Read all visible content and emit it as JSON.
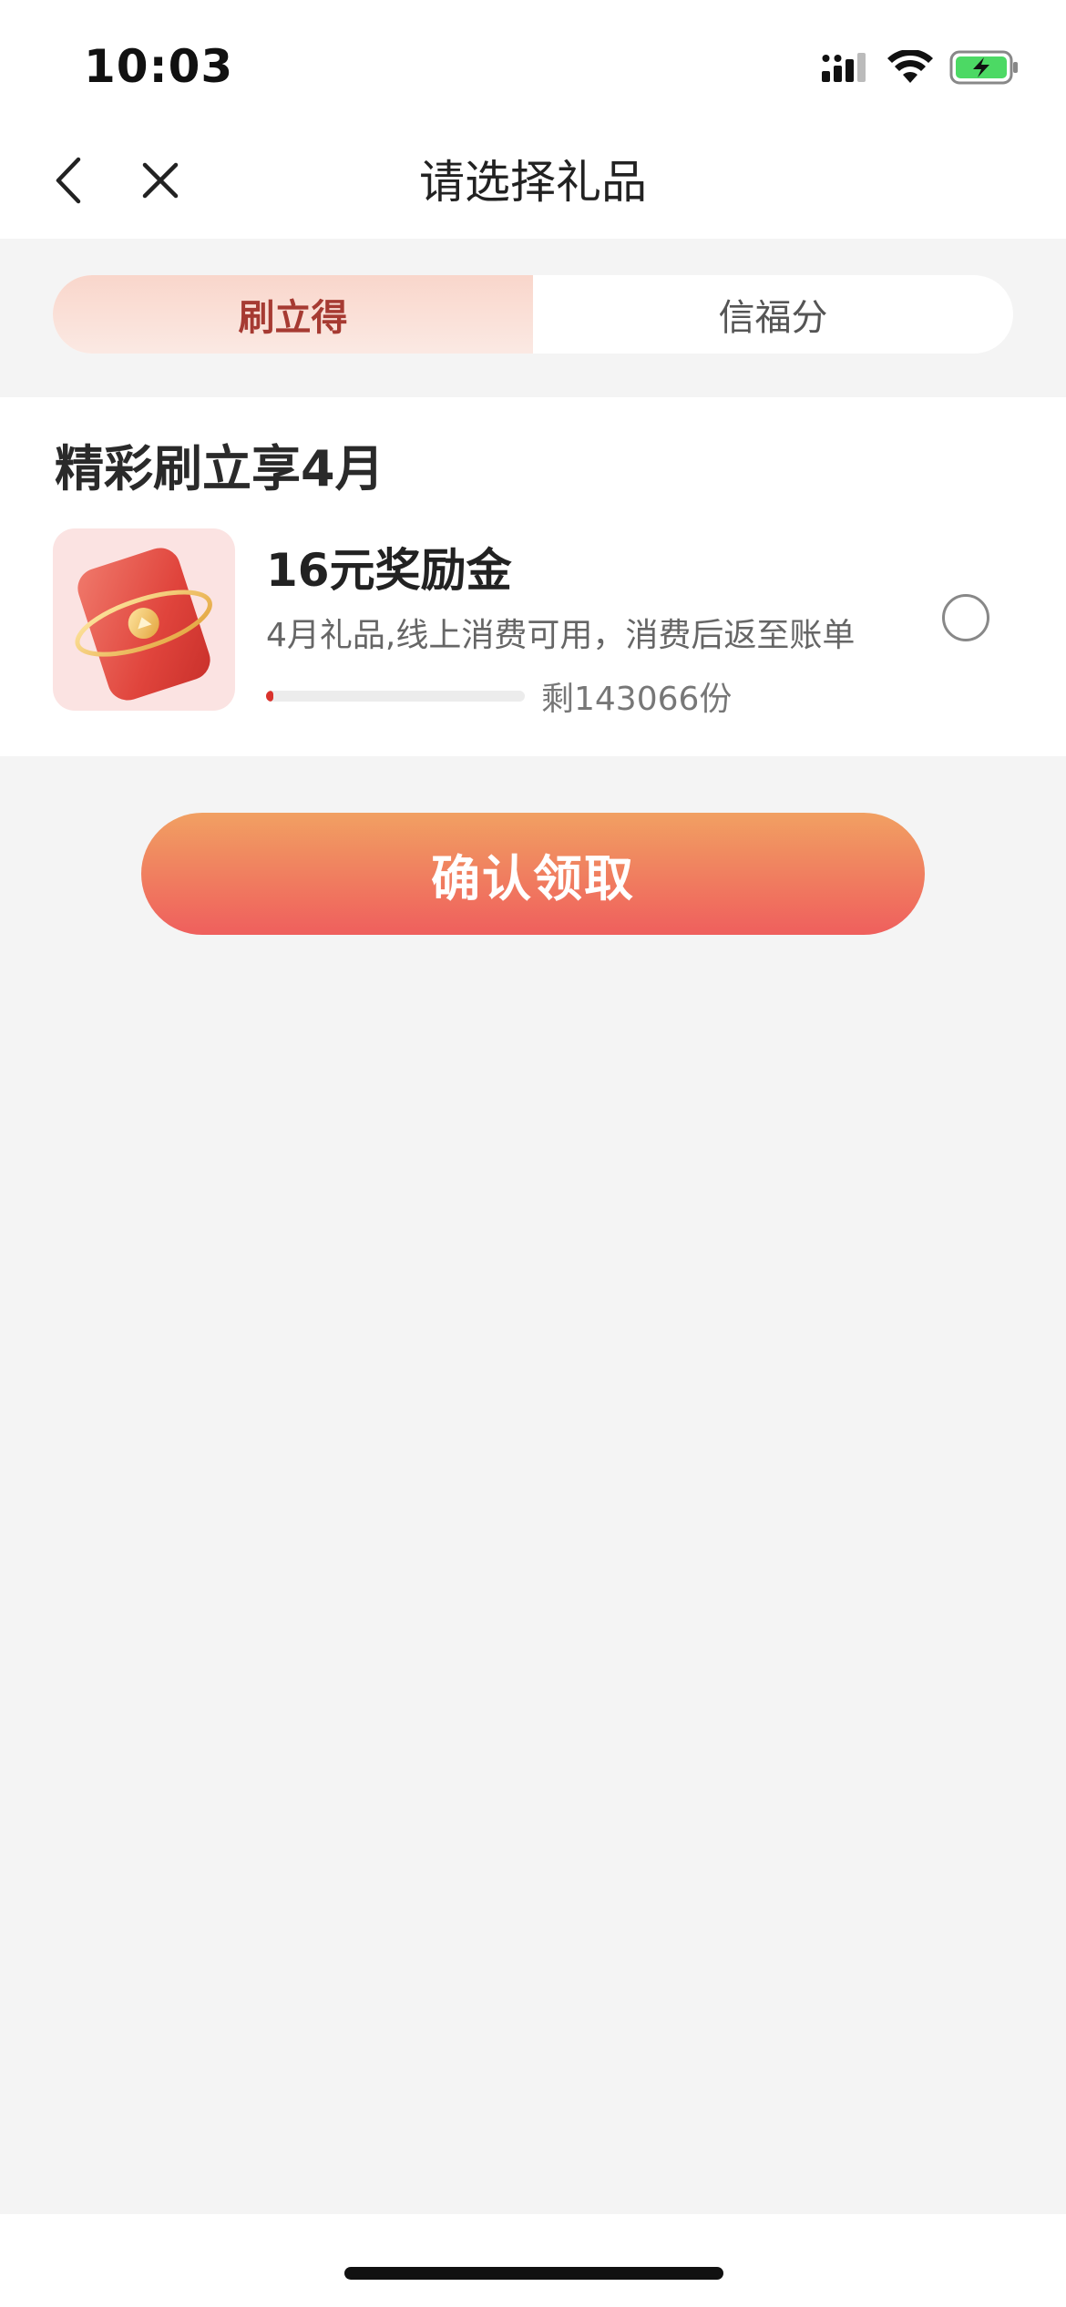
{
  "status_bar": {
    "time": "10:03"
  },
  "nav": {
    "title": "请选择礼品"
  },
  "tabs": [
    {
      "label": "刷立得",
      "active": true
    },
    {
      "label": "信福分",
      "active": false
    }
  ],
  "section": {
    "title": "精彩刷立享4月"
  },
  "gift": {
    "name": "16元奖励金",
    "description": "4月礼品,线上消费可用，消费后返至账单",
    "remaining": "剩143066份",
    "selected": false
  },
  "confirm_label": "确认领取",
  "colors": {
    "accent": "#d9322c",
    "button_top": "#f1a062",
    "button_bottom": "#ef5f5d",
    "tab_active_text": "#a63a32"
  }
}
